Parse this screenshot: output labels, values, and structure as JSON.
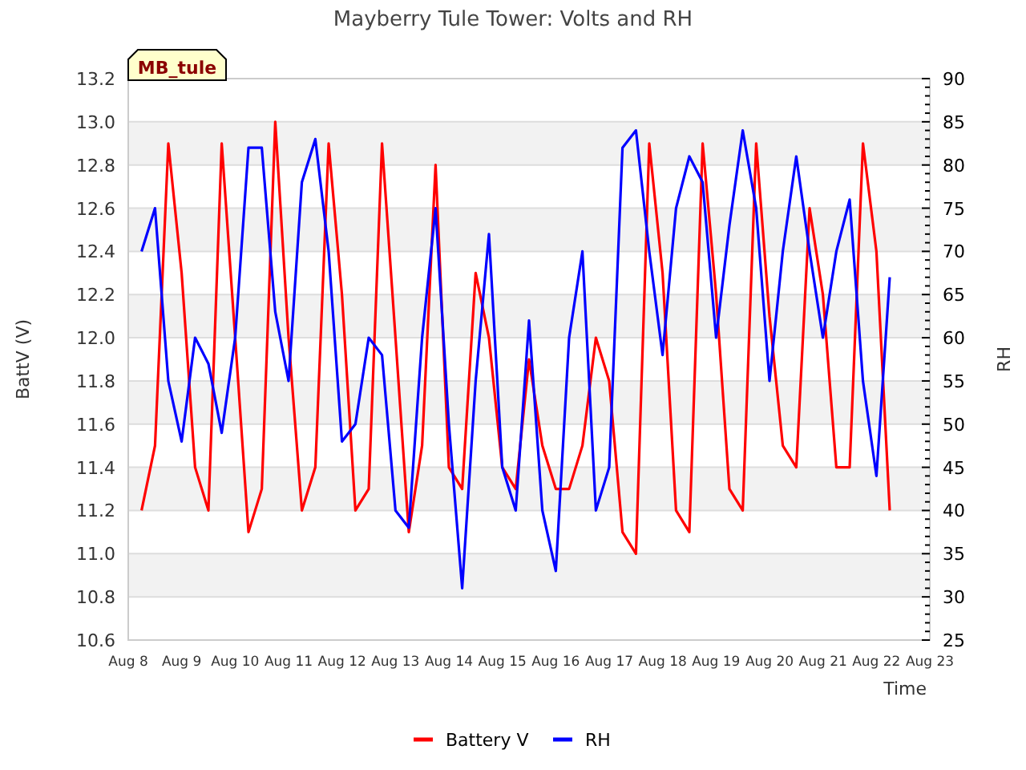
{
  "chart": {
    "badge": "MB_tule",
    "chart_data": {
      "type": "line",
      "title": "Mayberry Tule Tower: Volts and RH",
      "xlabel": "Time",
      "ylabel": "BattV (V)",
      "y2label": "RH",
      "categories": [
        "Aug 8",
        null,
        null,
        null,
        "Aug 9",
        null,
        null,
        null,
        "Aug 10",
        null,
        null,
        null,
        "Aug 11",
        null,
        null,
        null,
        "Aug 12",
        null,
        null,
        null,
        "Aug 13",
        null,
        null,
        null,
        "Aug 14",
        null,
        null,
        null,
        "Aug 15",
        null,
        null,
        null,
        "Aug 16",
        null,
        null,
        null,
        "Aug 17",
        null,
        null,
        null,
        "Aug 18",
        null,
        null,
        null,
        "Aug 19",
        null,
        null,
        null,
        "Aug 20",
        null,
        null,
        null,
        "Aug 21",
        null,
        null,
        null,
        "Aug 22",
        null,
        null,
        null,
        "Aug 23"
      ],
      "series": [
        {
          "name": "Battery V",
          "color": "#ff0000",
          "values": [
            null,
            11.2,
            11.5,
            12.9,
            12.3,
            11.4,
            11.2,
            12.9,
            12.0,
            11.1,
            11.3,
            13.0,
            12.0,
            11.2,
            11.4,
            12.9,
            12.2,
            11.2,
            11.3,
            12.9,
            12.0,
            11.1,
            11.5,
            12.8,
            11.4,
            11.3,
            12.3,
            12.0,
            11.4,
            11.3,
            11.9,
            11.5,
            11.3,
            11.3,
            11.5,
            12.0,
            11.8,
            11.1,
            11.0,
            12.9,
            12.3,
            11.2,
            11.1,
            12.9,
            12.2,
            11.3,
            11.2,
            12.9,
            12.1,
            11.5,
            11.4,
            12.6,
            12.2,
            11.4,
            11.4,
            12.9,
            12.4,
            11.2,
            null,
            null,
            null
          ]
        },
        {
          "name": "RH",
          "color": "#0000ff",
          "axis": "y2",
          "values": [
            null,
            70,
            75,
            55,
            48,
            60,
            57,
            49,
            60,
            82,
            82,
            63,
            55,
            78,
            83,
            70,
            48,
            50,
            60,
            58,
            40,
            38,
            60,
            75,
            50,
            31,
            55,
            72,
            45,
            40,
            62,
            40,
            33,
            60,
            70,
            40,
            45,
            82,
            84,
            70,
            58,
            75,
            81,
            78,
            60,
            73,
            84,
            75,
            55,
            70,
            81,
            70,
            60,
            70,
            76,
            55,
            44,
            67,
            null,
            null,
            null
          ]
        }
      ],
      "grid": true,
      "legend": "bottom",
      "ylim": [
        10.6,
        13.2
      ],
      "y2lim": [
        25,
        90
      ],
      "yticks": [
        {
          "value": 10.6,
          "label": "10.6"
        },
        {
          "value": 10.8,
          "label": "10.8"
        },
        {
          "value": 11.0,
          "label": "11.0"
        },
        {
          "value": 11.2,
          "label": "11.2"
        },
        {
          "value": 11.4,
          "label": "11.4"
        },
        {
          "value": 11.6,
          "label": "11.6"
        },
        {
          "value": 11.8,
          "label": "11.8"
        },
        {
          "value": 12.0,
          "label": "12.0"
        },
        {
          "value": 12.2,
          "label": "12.2"
        },
        {
          "value": 12.4,
          "label": "12.4"
        },
        {
          "value": 12.6,
          "label": "12.6"
        },
        {
          "value": 12.8,
          "label": "12.8"
        },
        {
          "value": 13.0,
          "label": "13.0"
        },
        {
          "value": 13.2,
          "label": "13.2"
        }
      ],
      "y2ticks": [
        25,
        30,
        35,
        40,
        45,
        50,
        55,
        60,
        65,
        70,
        75,
        80,
        85,
        90
      ]
    }
  }
}
